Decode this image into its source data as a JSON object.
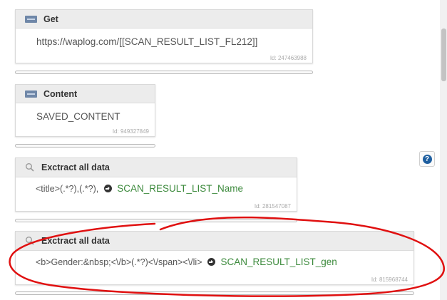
{
  "blocks": [
    {
      "title": "Get",
      "icon": "http-icon",
      "content": "https://waplog.com/[[SCAN_RESULT_LIST_FL212]]",
      "id_label": "Id: 247463988"
    },
    {
      "title": "Content",
      "icon": "http-icon",
      "content": "SAVED_CONTENT",
      "id_label": "Id: 949327849"
    },
    {
      "title": "Exctract all data",
      "icon": "search-icon",
      "pattern": "<title>(.*?),(.*?),",
      "variable": "SCAN_RESULT_LIST_Name",
      "id_label": "Id: 281547087"
    },
    {
      "title": "Exctract all data",
      "icon": "search-icon",
      "pattern": "<b>Gender:&nbsp;<\\/b>(.*?)<\\/span><\\/li>",
      "variable": "SCAN_RESULT_LIST_gen",
      "id_label": "Id: 815968744"
    }
  ],
  "help_button": {
    "label": "?"
  },
  "colors": {
    "header_bg": "#ececec",
    "variable_text": "#3c8a3c",
    "annotation": "#e01010",
    "help_icon": "#1f5fa0"
  }
}
